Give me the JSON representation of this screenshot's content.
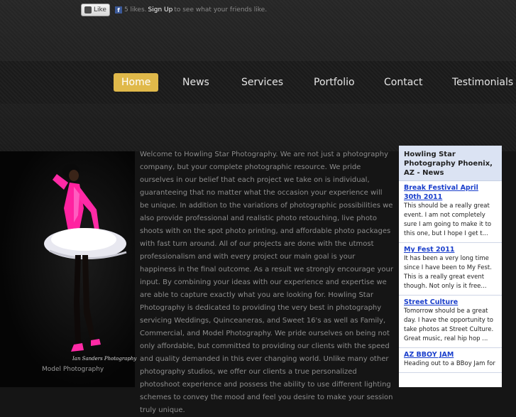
{
  "facebook": {
    "like_label": "Like",
    "fb_glyph": "f",
    "likes_text": "5 likes.",
    "signup_label": "Sign Up",
    "suffix_text": "to see what your friends like."
  },
  "nav": {
    "items": [
      {
        "label": "Home",
        "active": true
      },
      {
        "label": "News"
      },
      {
        "label": "Services"
      },
      {
        "label": "Portfolio"
      },
      {
        "label": "Contact"
      },
      {
        "label": "Testimonials"
      }
    ],
    "active_color": "#e0b94a"
  },
  "photo": {
    "credit": "Ian Sanders Photography",
    "caption": "Model Photography"
  },
  "intro_text": "Welcome to Howling Star Photography. We are not just a photography company, but your complete photographic resource. We pride ourselves in our belief that each project we take on is individual, guaranteeing that no matter what the occasion your experience will be unique. In addition to the variations of photographic possibilities we also provide professional and realistic photo retouching, live photo shoots with on the spot photo printing, and affordable photo packages with fast turn around. All of our projects are done with the utmost professionalism and with every project our main goal is your happiness in the final outcome. As a result we strongly encourage your input. By combining your ideas with our experience and expertise we are able to capture exactly what you are looking for. Howling Star Photography is dedicated to providing the very best in photography servicing Weddings, Quinceaneras, and Sweet 16's as well as Family, Commercial, and Model Photography. We pride ourselves on being not only affordable, but committed to providing our clients with the speed and quality demanded in this ever changing world. Unlike many other photography studios, we offer our clients a true personalized photoshoot experience and possess the ability to use different lighting schemes to convey the mood and feel you desire to make your session truly unique.",
  "news": {
    "heading": "Howling Star Photography Phoenix, AZ - News",
    "items": [
      {
        "title": "Break Festival April 30th 2011",
        "text": "This should be a really great event. I am not completely sure I am going to make it to this one, but I hope I get t..."
      },
      {
        "title": "My Fest 2011",
        "text": "It has been a very long time since I have been to My Fest. This is a really great event though. Not only is it free..."
      },
      {
        "title": "Street Culture",
        "text": "Tomorrow should be a great day. I have the opportunity to take photos at Street Culture. Great music, real hip hop ..."
      },
      {
        "title": "AZ BBOY JAM",
        "text": "Heading out to a BBoy Jam for"
      }
    ],
    "link_color": "#1a3fcc",
    "header_color": "#dbe3f3"
  }
}
